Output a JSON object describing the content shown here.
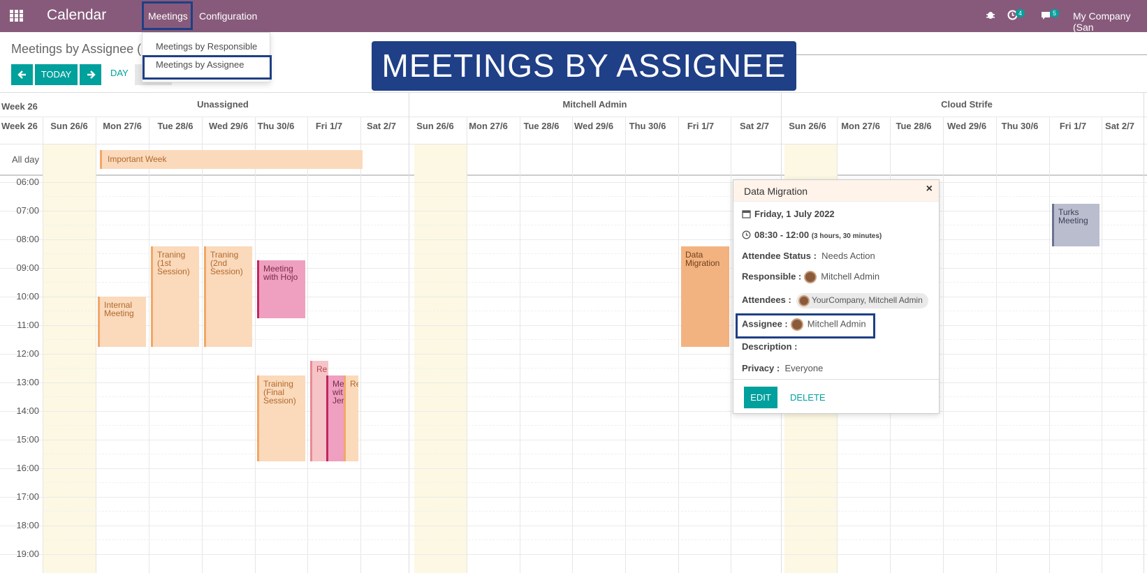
{
  "navbar": {
    "brand": "Calendar",
    "menus": [
      "Meetings",
      "Configuration"
    ],
    "activity_count": "4",
    "messages_count": "5",
    "company": "My Company (San"
  },
  "dropdown": {
    "items": [
      "Meetings by Responsible",
      "Meetings by Assignee"
    ]
  },
  "page": {
    "title": "Meetings by Assignee (",
    "today": "TODAY",
    "day": "DAY"
  },
  "banner": "MEETINGS BY ASSIGNEE",
  "calendar": {
    "week_label": "Week 26",
    "groups": [
      "Unassigned",
      "Mitchell Admin",
      "Cloud Strife"
    ],
    "days": [
      "Sun 26/6",
      "Mon 27/6",
      "Tue 28/6",
      "Wed 29/6",
      "Thu 30/6",
      "Fri 1/7",
      "Sat 2/7"
    ],
    "allday_label": "All day",
    "hours": [
      "06:00",
      "07:00",
      "08:00",
      "09:00",
      "10:00",
      "11:00",
      "12:00",
      "13:00",
      "14:00",
      "15:00",
      "16:00",
      "17:00",
      "18:00",
      "19:00"
    ],
    "events": {
      "important_week": "Important Week",
      "internal_meeting": "Internal Meeting",
      "training_1": "Traning (1st Session)",
      "training_2": "Traning (2nd Session)",
      "meeting_hojo": "Meeting with Hojo",
      "training_final": "Training (Final Session)",
      "re1": "Re",
      "me_jen": "Me wit Jer",
      "re2": "Re",
      "data_migration": "Data Migration",
      "turks": "Turks Meeting"
    }
  },
  "popover": {
    "title": "Data Migration",
    "date": "Friday, 1 July 2022",
    "time": "08:30 - 12:00",
    "duration": "(3 hours, 30 minutes)",
    "status_label": "Attendee Status :",
    "status_value": "Needs Action",
    "responsible_label": "Responsible :",
    "responsible_value": "Mitchell Admin",
    "attendees_label": "Attendees :",
    "attendees_value": "YourCompany, Mitchell Admin",
    "assignee_label": "Assignee :",
    "assignee_value": "Mitchell Admin",
    "description_label": "Description :",
    "privacy_label": "Privacy :",
    "privacy_value": "Everyone",
    "edit": "EDIT",
    "delete": "DELETE"
  }
}
